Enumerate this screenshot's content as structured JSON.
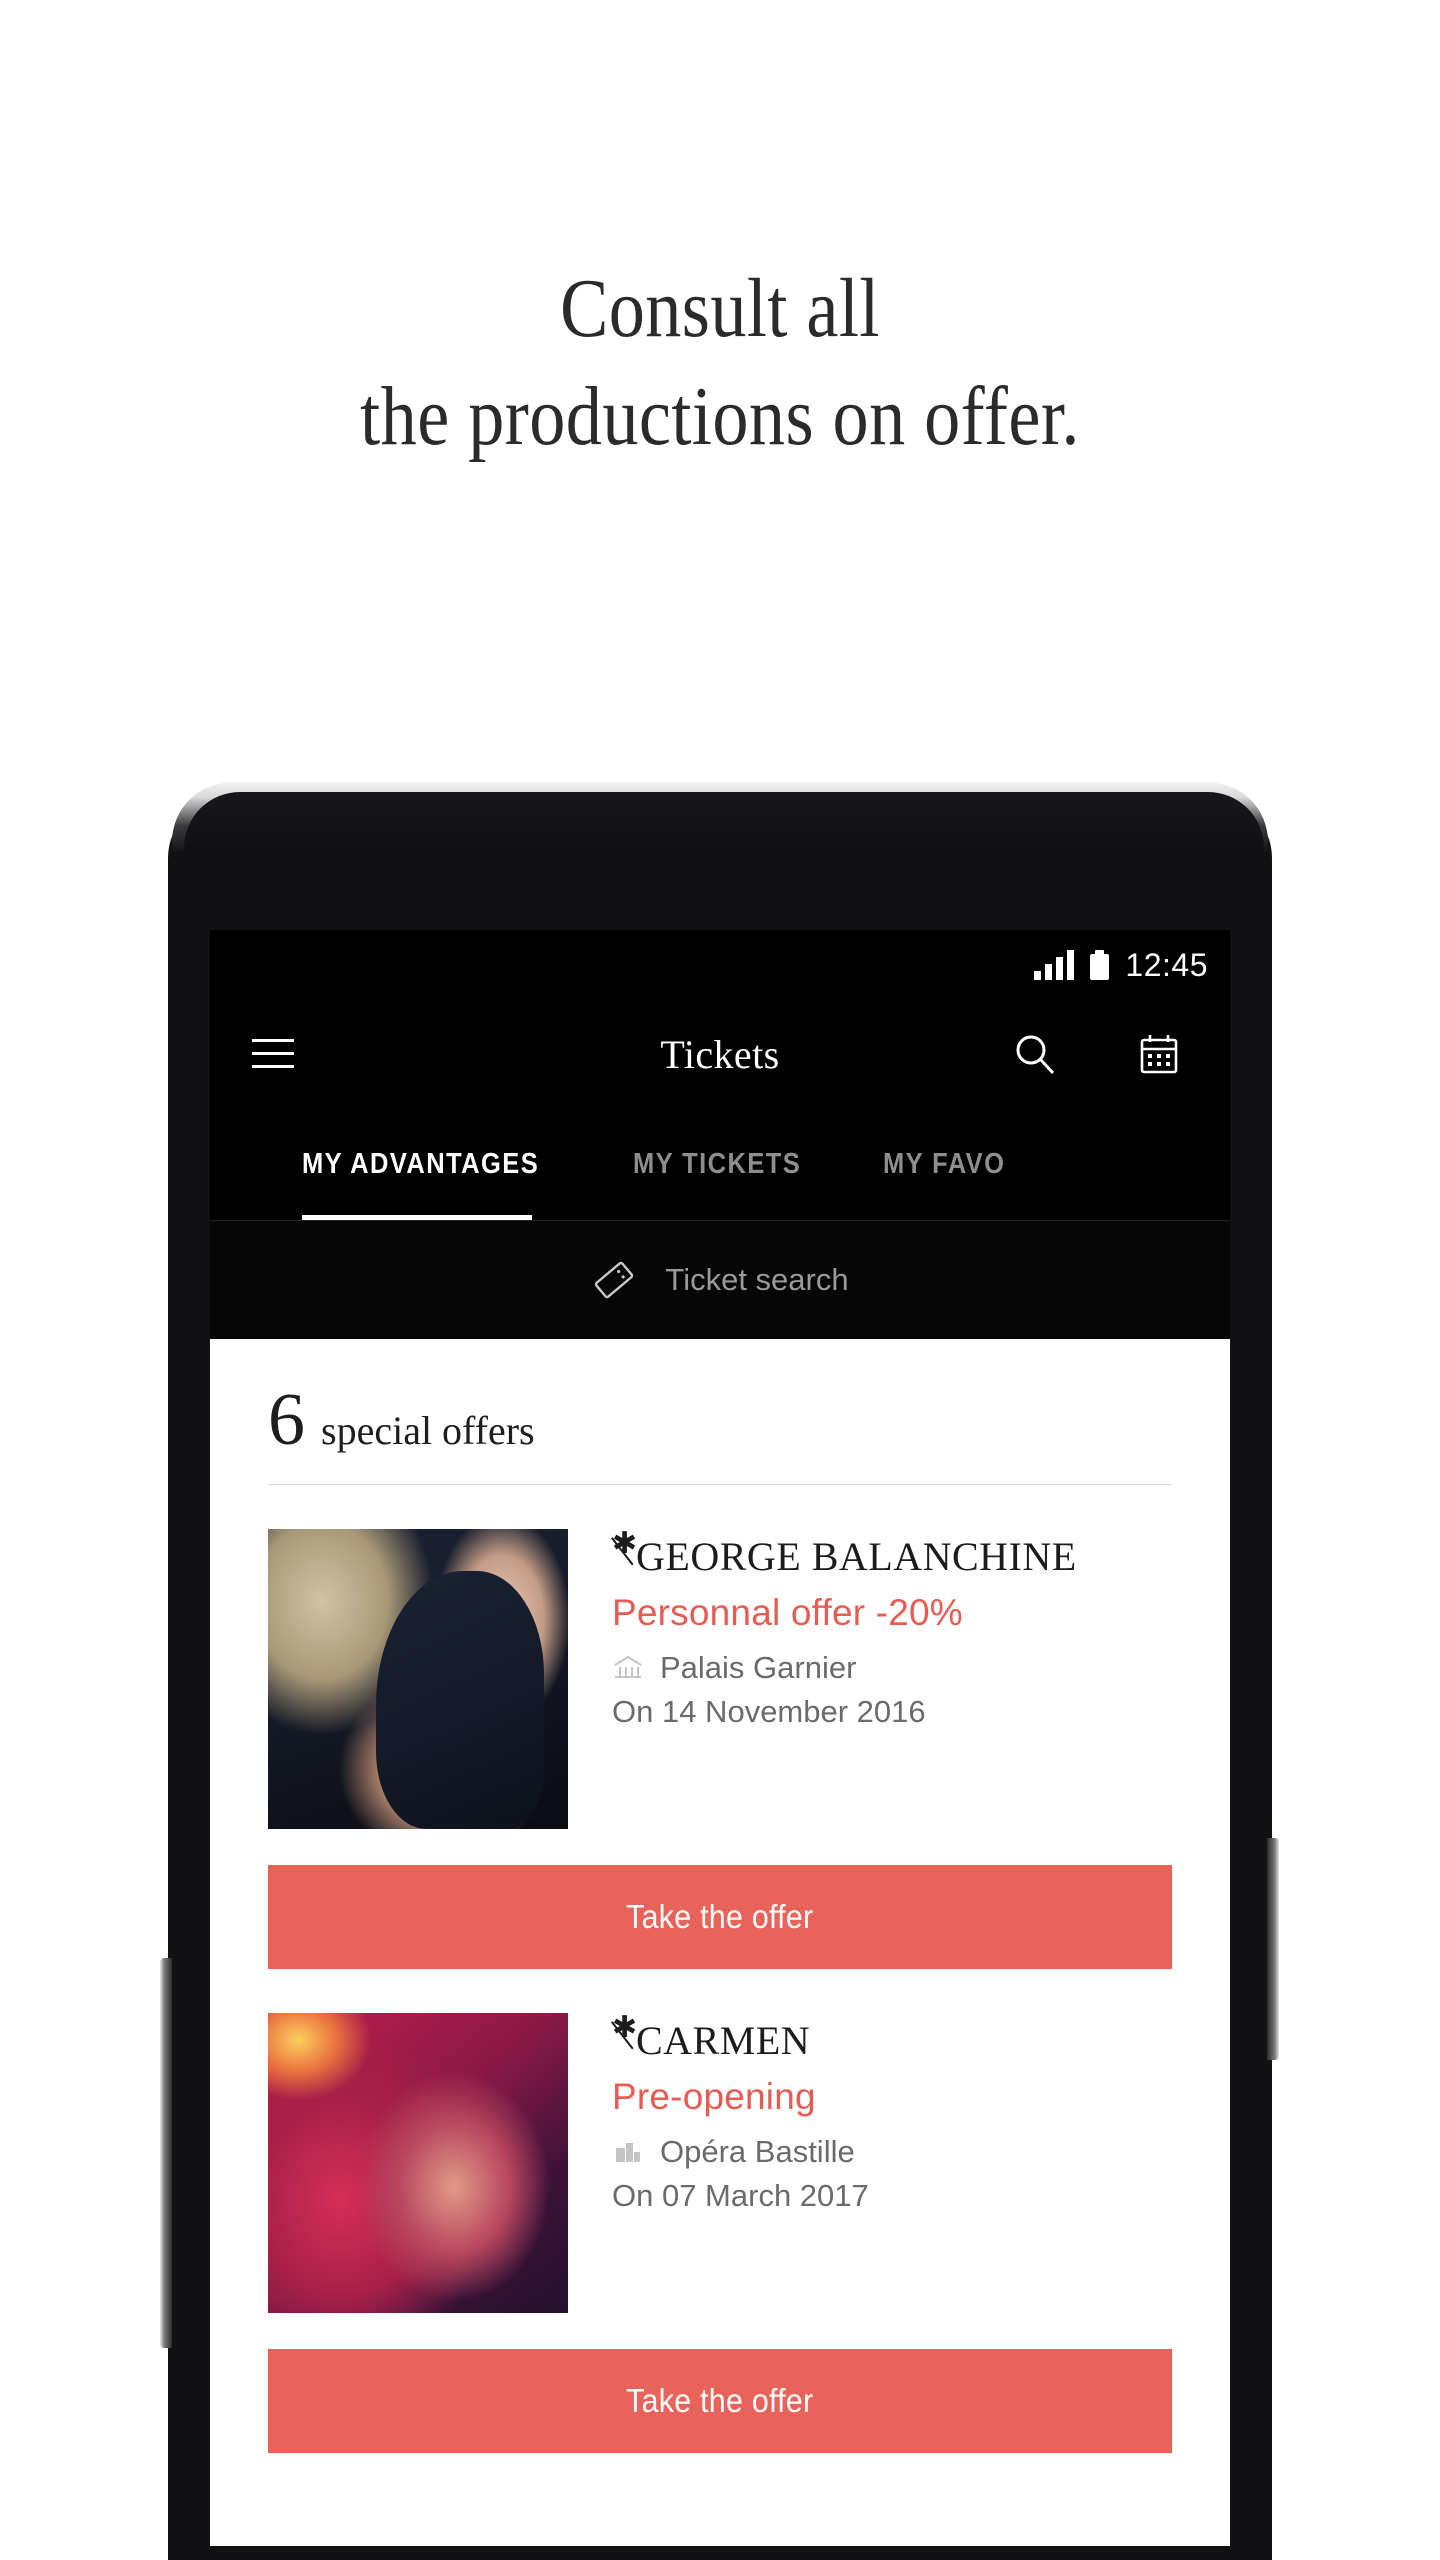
{
  "promo": {
    "line1": "Consult all",
    "line2": "the productions on offer."
  },
  "device": {
    "camera_icon": "front-camera",
    "speaker_icon": "earpiece-speaker",
    "volume_button": "volume-rocker",
    "power_button": "power-button"
  },
  "status_bar": {
    "signal_icon": "signal-bars",
    "battery_icon": "battery-full",
    "time": "12:45"
  },
  "app_bar": {
    "menu_icon": "hamburger-menu",
    "title": "Tickets",
    "search_icon": "search-icon",
    "calendar_icon": "calendar-icon"
  },
  "tabs": [
    {
      "label": "MY ADVANTAGES",
      "active": true
    },
    {
      "label": "MY TICKETS",
      "active": false
    },
    {
      "label": "MY FAVO",
      "active": false
    }
  ],
  "ticket_search": {
    "icon": "ticket-icon",
    "label": "Ticket search"
  },
  "offers_header": {
    "count": "6",
    "label": "special offers"
  },
  "offers": [
    {
      "title": "GEORGE BALANCHINE",
      "subtitle": "Personnal offer -20%",
      "venue": "Palais Garnier",
      "venue_icon": "opera-house-icon",
      "date": "On 14 November 2016",
      "cta": "Take the offer",
      "thumb": "ballet-dancers-photo"
    },
    {
      "title": "CARMEN",
      "subtitle": "Pre-opening",
      "venue": "Opéra Bastille",
      "venue_icon": "building-icon",
      "date": "On 07 March 2017",
      "cta": "Take the offer",
      "thumb": "carmen-red-stage-photo"
    }
  ],
  "colors": {
    "accent": "#e8635a",
    "accent_text": "#e65c52",
    "app_bar_bg": "#000000",
    "page_bg": "#ffffff",
    "muted_text": "#6b6b6b",
    "tab_inactive": "#8e8e8e"
  }
}
